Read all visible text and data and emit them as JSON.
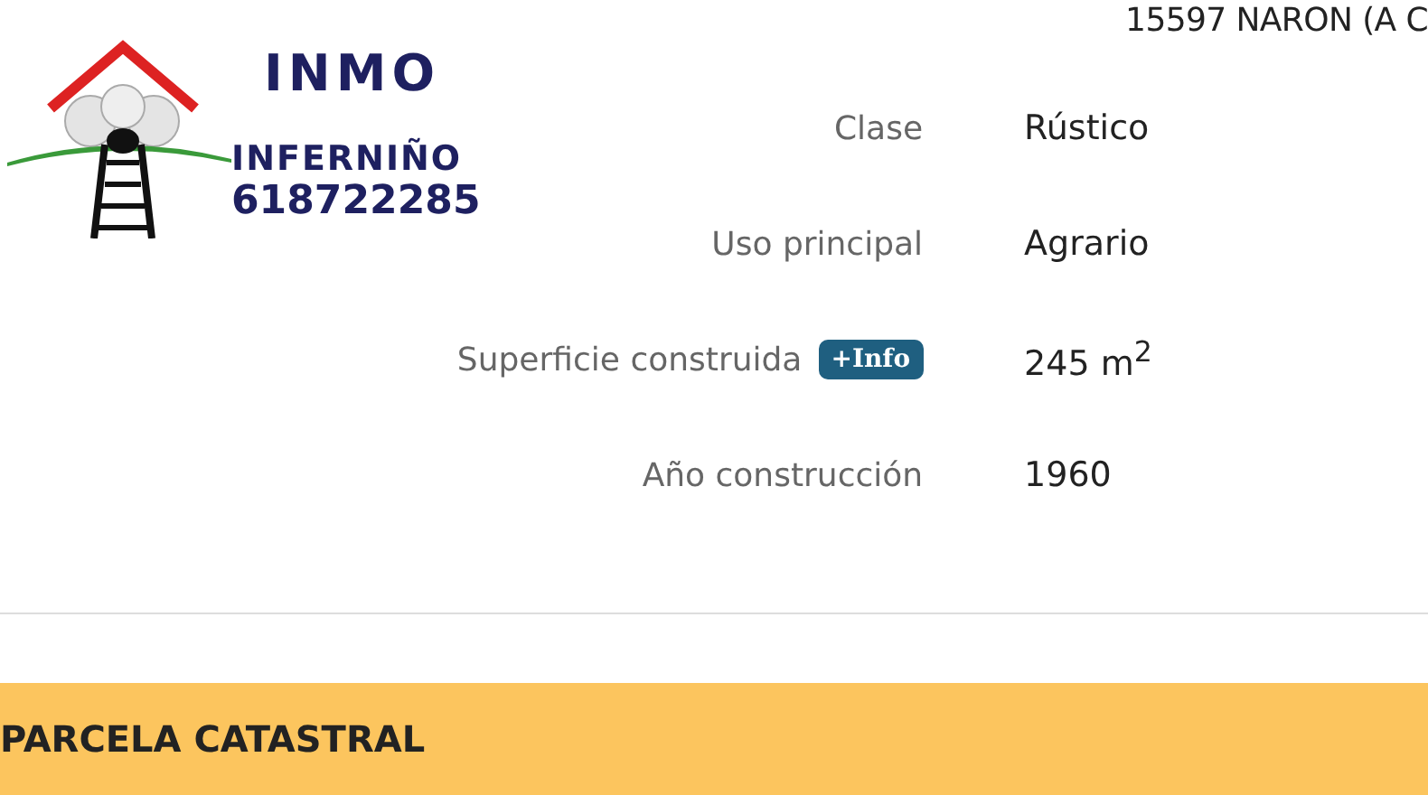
{
  "logo": {
    "brand": "INMO",
    "name": "INFERNIÑO",
    "phone": "618722285"
  },
  "address": "15597 NARON (A C",
  "rows": [
    {
      "label": "Clase",
      "value": "Rústico"
    },
    {
      "label": "Uso principal",
      "value": "Agrario"
    },
    {
      "label": "Superficie construida",
      "badge": "+Info",
      "value": "245 m$^{2}$"
    },
    {
      "label": "Año construcción",
      "value": "1960"
    }
  ],
  "section_title": "PARCELA CATASTRAL"
}
